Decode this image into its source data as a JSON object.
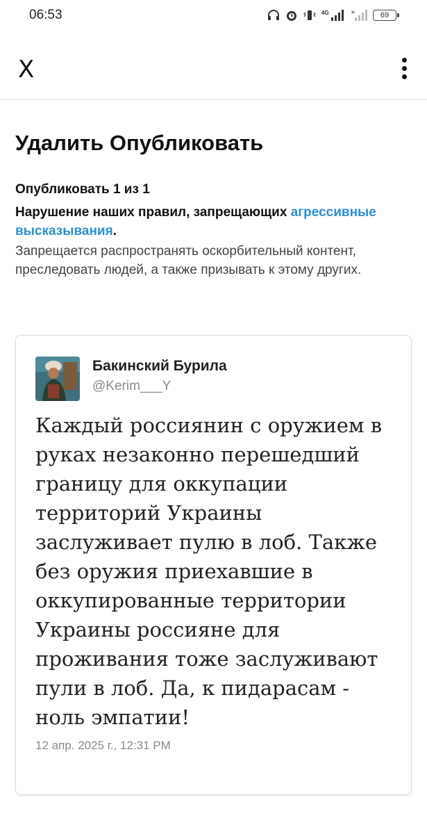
{
  "status_bar": {
    "time": "06:53",
    "battery": "69",
    "icons": [
      "headphones-icon",
      "alarm-icon",
      "vibrate-icon",
      "signal-4g-icon",
      "signal-icon",
      "battery-icon"
    ]
  },
  "top_bar": {
    "close_label": "X",
    "more_icon": "more-vertical-icon"
  },
  "page": {
    "title": "Удалить Опубликовать",
    "count": "Опубликовать 1 из 1",
    "rule_prefix": "Нарушение наших правил, запрещающих",
    "rule_link": "агрессивные высказывания",
    "rule_suffix": ".",
    "description": "Запрещается распространять оскорбительный контент, преследовать людей, а также призывать к этому других."
  },
  "tweet": {
    "display_name": "Бакинский Бурила",
    "handle": "@Kerim___Y",
    "text": "Каждый россиянин с оружием в руках незаконно перешедший границу для оккупации территорий Украины заслуживает пулю в лоб. Также без оружия приехавшие в оккупированные территории Украины россияне для проживания тоже заслуживают пули в лоб. Да, к пидарасам - ноль эмпатии!",
    "timestamp": "12 апр. 2025 г., 12:31 PM"
  },
  "colors": {
    "link": "#2b8fd9",
    "muted": "#8a8a8a"
  }
}
